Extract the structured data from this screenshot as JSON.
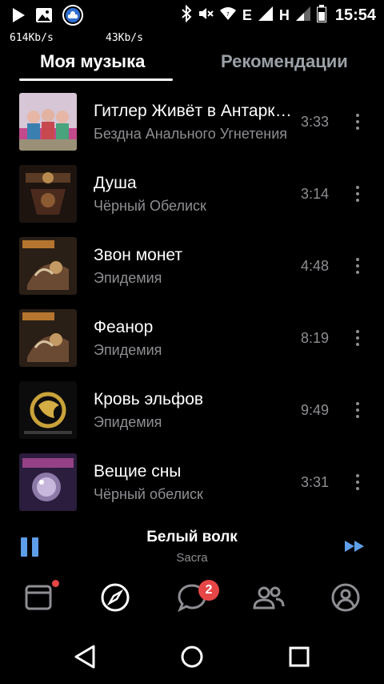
{
  "status_bar": {
    "time": "15:54",
    "net_down": "614Kb/s",
    "net_up": "43Kb/s",
    "signal1_type": "E",
    "signal2_type": "H"
  },
  "tabs": [
    {
      "label": "Моя музыка",
      "active": true
    },
    {
      "label": "Рекомендации",
      "active": false
    }
  ],
  "tracks": [
    {
      "title": "Гитлер Живёт в Антарктиде",
      "artist": "Бездна Анального Угнетения",
      "duration": "3:33"
    },
    {
      "title": "Душа",
      "artist": "Чёрный Обелиск",
      "duration": "3:14"
    },
    {
      "title": "Звон монет",
      "artist": "Эпидемия",
      "duration": "4:48"
    },
    {
      "title": "Феанор",
      "artist": "Эпидемия",
      "duration": "8:19"
    },
    {
      "title": "Кровь эльфов",
      "artist": "Эпидемия",
      "duration": "9:49"
    },
    {
      "title": "Вещие сны",
      "artist": "Чёрный обелиск",
      "duration": "3:31"
    }
  ],
  "now_playing": {
    "title": "Белый волк",
    "artist": "Sacra"
  },
  "bottom_nav": {
    "messages_badge": "2"
  },
  "colors": {
    "accent": "#5e9ee8",
    "badge": "#e64646",
    "secondary_text": "#8e8e93",
    "background": "#000000"
  },
  "icons": [
    "play-icon",
    "image-icon",
    "vk-cloud-icon",
    "bluetooth-icon",
    "mute-icon",
    "wifi-icon",
    "signal-icon",
    "battery-icon",
    "pause-icon",
    "fast-forward-icon",
    "feed-icon",
    "compass-icon",
    "chat-icon",
    "friends-icon",
    "profile-icon",
    "back-icon",
    "home-icon",
    "recents-icon",
    "more-vertical-icon"
  ]
}
